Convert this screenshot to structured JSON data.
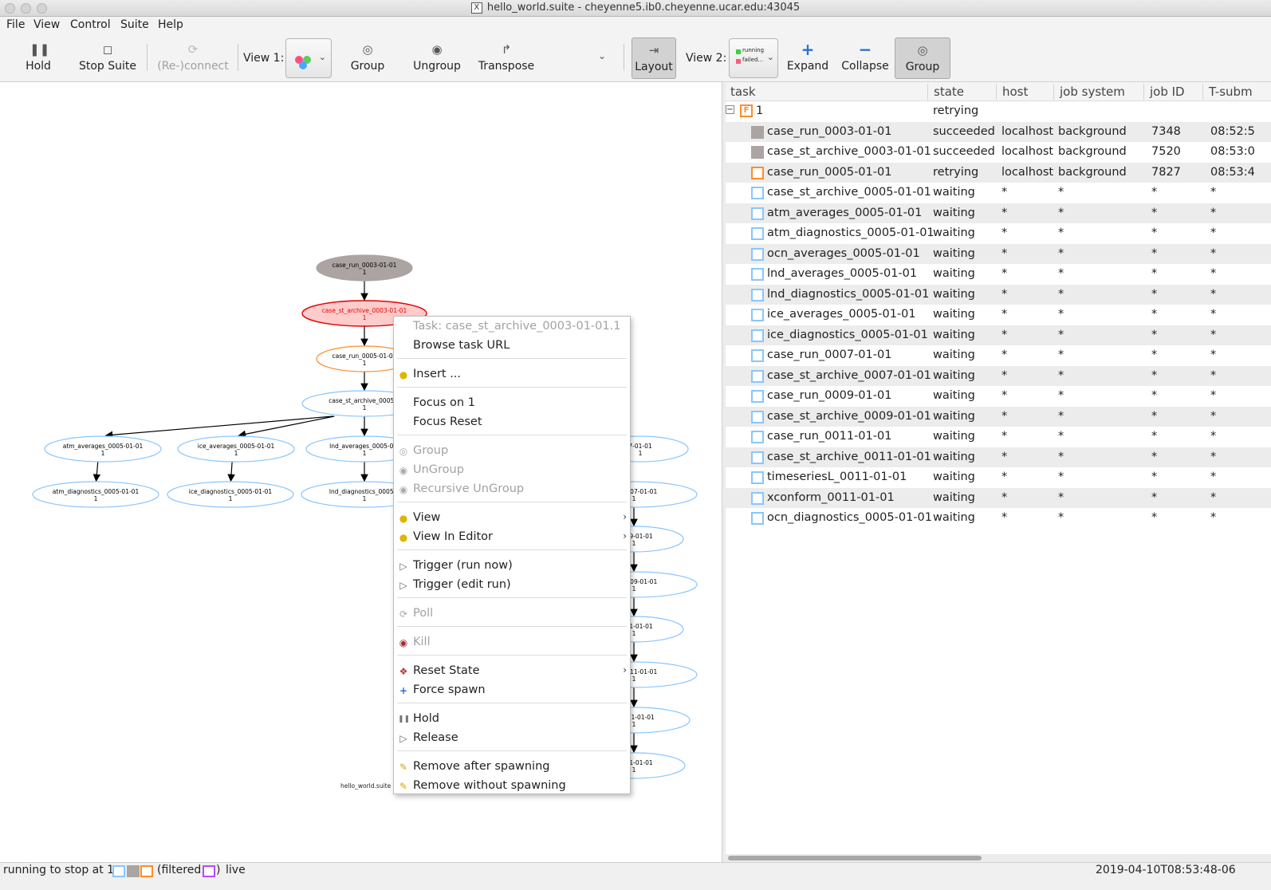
{
  "window": {
    "title": "hello_world.suite - cheyenne5.ib0.cheyenne.ucar.edu:43045"
  },
  "menubar": [
    "File",
    "View",
    "Control",
    "Suite",
    "Help"
  ],
  "toolbar": {
    "hold": "Hold",
    "stop_suite": "Stop Suite",
    "reconnect": "(Re-)connect",
    "view1_label": "View 1:",
    "group": "Group",
    "ungroup": "Ungroup",
    "transpose": "Transpose",
    "layout": "Layout",
    "view2_label": "View 2:",
    "view2_legend": [
      "running",
      "failed..."
    ],
    "expand": "Expand",
    "collapse": "Collapse",
    "group2": "Group"
  },
  "graph": {
    "footer": "hello_world.suite",
    "nodes": [
      {
        "label": "case_run_0003-01-01",
        "cycle": "1",
        "state": "succeeded"
      },
      {
        "label": "case_st_archive_0003-01-01",
        "cycle": "1",
        "state": "selected"
      },
      {
        "label": "case_run_0005-01-01",
        "cycle": "1",
        "state": "retrying"
      },
      {
        "label": "case_st_archive_0005-0",
        "cycle": "1",
        "state": "waiting"
      },
      {
        "label": "atm_averages_0005-01-01",
        "cycle": "1",
        "state": "waiting"
      },
      {
        "label": "ice_averages_0005-01-01",
        "cycle": "1",
        "state": "waiting"
      },
      {
        "label": "lnd_averages_0005-01-",
        "cycle": "1",
        "state": "waiting"
      },
      {
        "label": "7-01-01",
        "cycle": "1",
        "state": "waiting"
      },
      {
        "label": "atm_diagnostics_0005-01-01",
        "cycle": "1",
        "state": "waiting"
      },
      {
        "label": "ice_diagnostics_0005-01-01",
        "cycle": "1",
        "state": "waiting"
      },
      {
        "label": "lnd_diagnostics_0005-0",
        "cycle": "1",
        "state": "waiting"
      },
      {
        "label": "ive_0007-01-01",
        "cycle": "1",
        "state": "waiting"
      },
      {
        "label": "_0009-01-01",
        "cycle": "1",
        "state": "waiting"
      },
      {
        "label": "ive_0009-01-01",
        "cycle": "1",
        "state": "waiting"
      },
      {
        "label": "_0011-01-01",
        "cycle": "1",
        "state": "waiting"
      },
      {
        "label": "ive_0011-01-01",
        "cycle": "1",
        "state": "waiting"
      },
      {
        "label": "L_0011-01-01",
        "cycle": "1",
        "state": "waiting"
      },
      {
        "label": "_0011-01-01",
        "cycle": "1",
        "state": "waiting"
      }
    ]
  },
  "context_menu": {
    "header": "Task: case_st_archive_0003-01-01.1",
    "browse": "Browse task URL",
    "insert": "Insert ...",
    "focus_on": "Focus on 1",
    "focus_reset": "Focus Reset",
    "group": "Group",
    "ungroup": "UnGroup",
    "recursive_ungroup": "Recursive UnGroup",
    "view": "View",
    "view_in_editor": "View In Editor",
    "trigger_run": "Trigger (run now)",
    "trigger_edit": "Trigger (edit run)",
    "poll": "Poll",
    "kill": "Kill",
    "reset_state": "Reset State",
    "force_spawn": "Force spawn",
    "hold": "Hold",
    "release": "Release",
    "remove_after": "Remove after spawning",
    "remove_without": "Remove without spawning"
  },
  "tree": {
    "columns": [
      "task",
      "state",
      "host",
      "job system",
      "job ID",
      "T-subm"
    ],
    "family": {
      "name": "1",
      "badge": "F",
      "state": "retrying"
    },
    "rows": [
      {
        "task": "case_run_0003-01-01",
        "state": "succeeded",
        "host": "localhost",
        "job_system": "background",
        "job_id": "7348",
        "t_submit": "08:52:5"
      },
      {
        "task": "case_st_archive_0003-01-01",
        "state": "succeeded",
        "host": "localhost",
        "job_system": "background",
        "job_id": "7520",
        "t_submit": "08:53:0"
      },
      {
        "task": "case_run_0005-01-01",
        "state": "retrying",
        "host": "localhost",
        "job_system": "background",
        "job_id": "7827",
        "t_submit": "08:53:4"
      },
      {
        "task": "case_st_archive_0005-01-01",
        "state": "waiting",
        "host": "*",
        "job_system": "*",
        "job_id": "*",
        "t_submit": "*"
      },
      {
        "task": "atm_averages_0005-01-01",
        "state": "waiting",
        "host": "*",
        "job_system": "*",
        "job_id": "*",
        "t_submit": "*"
      },
      {
        "task": "atm_diagnostics_0005-01-01",
        "state": "waiting",
        "host": "*",
        "job_system": "*",
        "job_id": "*",
        "t_submit": "*"
      },
      {
        "task": "ocn_averages_0005-01-01",
        "state": "waiting",
        "host": "*",
        "job_system": "*",
        "job_id": "*",
        "t_submit": "*"
      },
      {
        "task": "lnd_averages_0005-01-01",
        "state": "waiting",
        "host": "*",
        "job_system": "*",
        "job_id": "*",
        "t_submit": "*"
      },
      {
        "task": "lnd_diagnostics_0005-01-01",
        "state": "waiting",
        "host": "*",
        "job_system": "*",
        "job_id": "*",
        "t_submit": "*"
      },
      {
        "task": "ice_averages_0005-01-01",
        "state": "waiting",
        "host": "*",
        "job_system": "*",
        "job_id": "*",
        "t_submit": "*"
      },
      {
        "task": "ice_diagnostics_0005-01-01",
        "state": "waiting",
        "host": "*",
        "job_system": "*",
        "job_id": "*",
        "t_submit": "*"
      },
      {
        "task": "case_run_0007-01-01",
        "state": "waiting",
        "host": "*",
        "job_system": "*",
        "job_id": "*",
        "t_submit": "*"
      },
      {
        "task": "case_st_archive_0007-01-01",
        "state": "waiting",
        "host": "*",
        "job_system": "*",
        "job_id": "*",
        "t_submit": "*"
      },
      {
        "task": "case_run_0009-01-01",
        "state": "waiting",
        "host": "*",
        "job_system": "*",
        "job_id": "*",
        "t_submit": "*"
      },
      {
        "task": "case_st_archive_0009-01-01",
        "state": "waiting",
        "host": "*",
        "job_system": "*",
        "job_id": "*",
        "t_submit": "*"
      },
      {
        "task": "case_run_0011-01-01",
        "state": "waiting",
        "host": "*",
        "job_system": "*",
        "job_id": "*",
        "t_submit": "*"
      },
      {
        "task": "case_st_archive_0011-01-01",
        "state": "waiting",
        "host": "*",
        "job_system": "*",
        "job_id": "*",
        "t_submit": "*"
      },
      {
        "task": "timeseriesL_0011-01-01",
        "state": "waiting",
        "host": "*",
        "job_system": "*",
        "job_id": "*",
        "t_submit": "*"
      },
      {
        "task": "xconform_0011-01-01",
        "state": "waiting",
        "host": "*",
        "job_system": "*",
        "job_id": "*",
        "t_submit": "*"
      },
      {
        "task": "ocn_diagnostics_0005-01-01",
        "state": "waiting",
        "host": "*",
        "job_system": "*",
        "job_id": "*",
        "t_submit": "*"
      }
    ]
  },
  "statusbar": {
    "status": "running to stop at 1",
    "filtered": "(filtered:",
    "filtered_close": ")",
    "mode": "live",
    "timestamp": "2019-04-10T08:53:48-06"
  },
  "colors": {
    "waiting": "#88c6ff",
    "succeeded": "#aca3a3",
    "retrying": "#ff8c2a",
    "selected_fill": "#ffcccc",
    "selected_stroke": "#e00000",
    "filtered": "#b44cff"
  }
}
